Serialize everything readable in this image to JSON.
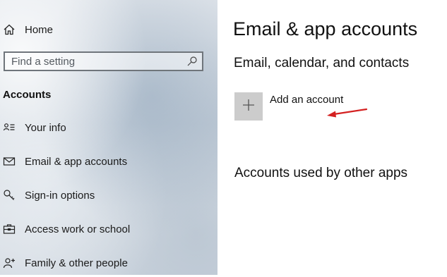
{
  "sidebar": {
    "home_label": "Home",
    "search_placeholder": "Find a setting",
    "section_heading": "Accounts",
    "items": [
      {
        "label": "Your info",
        "icon": "contact-card-icon"
      },
      {
        "label": "Email & app accounts",
        "icon": "mail-icon"
      },
      {
        "label": "Sign-in options",
        "icon": "key-icon"
      },
      {
        "label": "Access work or school",
        "icon": "briefcase-icon"
      },
      {
        "label": "Family & other people",
        "icon": "person-add-icon"
      }
    ]
  },
  "main": {
    "page_title": "Email & app accounts",
    "section_email": "Email, calendar, and contacts",
    "add_account_label": "Add an account",
    "section_other_apps": "Accounts used by other apps"
  },
  "colors": {
    "annotation_arrow": "#d42020",
    "add_tile_bg": "#cccccc"
  }
}
